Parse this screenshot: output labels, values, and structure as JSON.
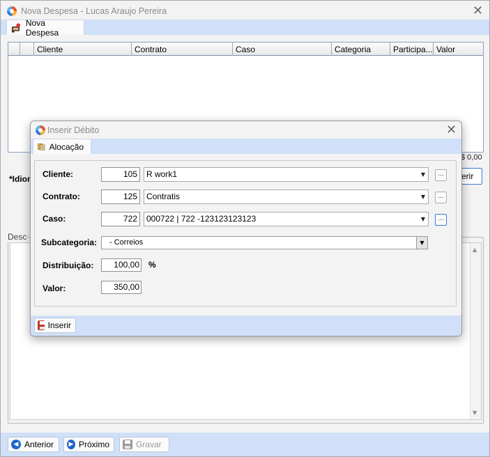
{
  "window": {
    "title": "Nova Despesa - Lucas Araujo Pereira",
    "tab_label": "Nova Despesa"
  },
  "grid": {
    "columns": [
      "",
      "Cliente",
      "Contrato",
      "Caso",
      "Categoria",
      "Participa...",
      "Valor"
    ],
    "total": "$ 0,00"
  },
  "labels": {
    "idioma": "*Idiom",
    "descricao": "Desc",
    "side_button": "erir"
  },
  "footer": {
    "anterior": "Anterior",
    "proximo": "Próximo",
    "gravar": "Gravar"
  },
  "modal": {
    "title": "Inserir Débito",
    "tab_label": "Alocação",
    "cliente": {
      "label": "Cliente:",
      "code": "105",
      "name": "R work1"
    },
    "contrato": {
      "label": "Contrato:",
      "code": "125",
      "name": "Contratis"
    },
    "caso": {
      "label": "Caso:",
      "code": "722",
      "name": "000722 | 722 -123123123123"
    },
    "subcategoria": {
      "label": "Subcategoria:",
      "value": "- Correios"
    },
    "distribuicao": {
      "label": "Distribuição:",
      "value": "100,00",
      "unit": "%"
    },
    "valor": {
      "label": "Valor:",
      "value": "350,00"
    },
    "ellipsis": "...",
    "insert_button": "Inserir"
  },
  "colors": {
    "accent": "#cfe0f8",
    "focus_border": "#3a7bd5",
    "icon_blue": "#1f66c9",
    "icon_disk": "#c0392b"
  },
  "icons": [
    "app-logo-icon",
    "close-icon",
    "expense-icon",
    "allocation-icon",
    "arrow-left-icon",
    "arrow-right-icon",
    "save-icon"
  ]
}
